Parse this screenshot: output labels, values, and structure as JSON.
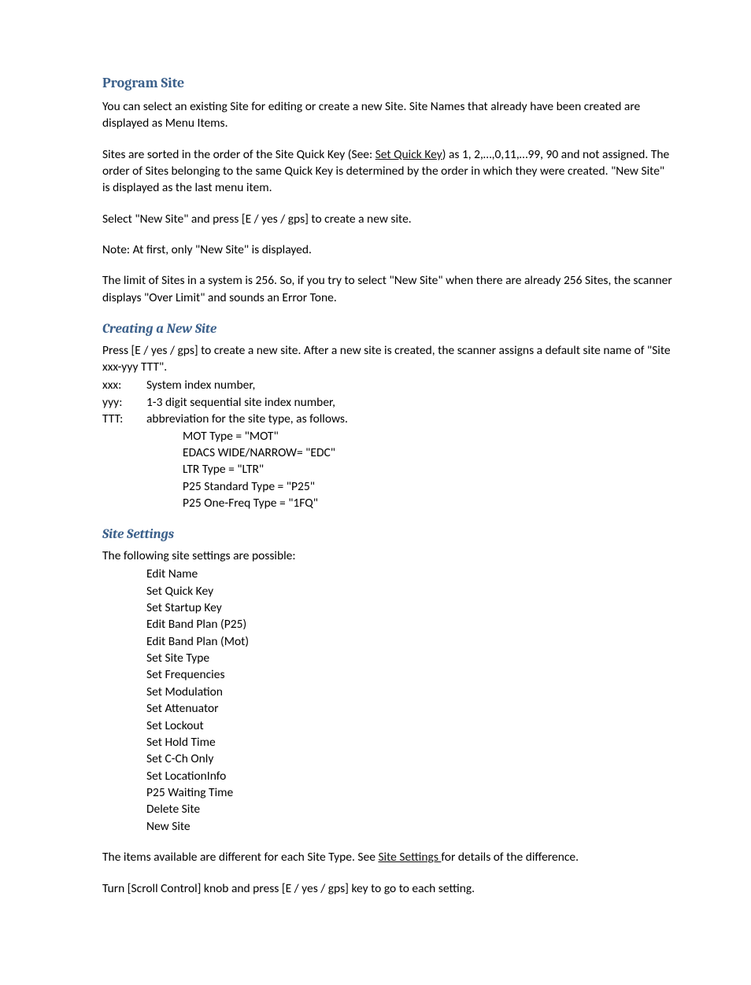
{
  "h1": "Program Site",
  "p1": "You can select an existing Site for editing or create a new Site. Site Names that already have been created are displayed as Menu Items.",
  "p2a": "Sites are sorted in the order of the Site Quick Key (See: ",
  "p2_link": "Set Quick Key",
  "p2b": ") as 1, 2,…,0,11,…99, 90 and not assigned. The order of Sites belonging to the same Quick Key is determined by the order in which they were created. \"New Site\" is displayed as the last menu item.",
  "p3": "Select \"New Site\" and press [E / yes / gps] to create a new site.",
  "p4": "Note: At first, only \"New Site\" is displayed.",
  "p5": "The limit of Sites in a system is 256. So, if you try to select \"New Site\" when there are already 256 Sites, the scanner displays \"Over Limit\" and sounds an Error Tone.",
  "h2a": "Creating a New Site",
  "p6": "Press [E / yes / gps] to create a new site. After a new site is created, the scanner assigns a default site name of \"Site xxx-yyy TTT\".",
  "defs": [
    {
      "label": " xxx:",
      "value": "System index number,"
    },
    {
      "label": "yyy:",
      "value": "1-3 digit sequential site index number,"
    },
    {
      "label": "TTT:",
      "value": "abbreviation for the site type, as follows."
    }
  ],
  "types": [
    "MOT Type = \"MOT\"",
    "EDACS WIDE/NARROW= \"EDC\"",
    "LTR Type = \"LTR\"",
    "P25 Standard Type = \"P25\"",
    "P25 One-Freq Type = \"1FQ\""
  ],
  "h2b": "Site Settings",
  "p7": "The following site settings are possible:",
  "settings": [
    "Edit Name",
    "Set Quick Key",
    "Set Startup Key",
    "Edit Band Plan (P25)",
    "Edit Band Plan (Mot)",
    "Set Site Type",
    "Set Frequencies",
    "Set Modulation",
    "Set Attenuator",
    "Set Lockout",
    "Set Hold Time",
    "Set C-Ch Only",
    "Set LocationInfo",
    "P25 Waiting Time",
    "Delete Site",
    "New Site"
  ],
  "p8a": "The items available are different for each Site Type. See ",
  "p8_link": "Site Settings ",
  "p8b": " for details of the difference.",
  "p9": "Turn [Scroll Control] knob and press [E / yes / gps] key to go to each setting."
}
